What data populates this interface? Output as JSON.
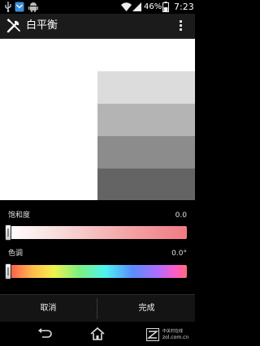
{
  "status_bar": {
    "battery_percent": "46%",
    "time": "7:23",
    "icons": [
      "usb-icon",
      "notification-icon",
      "android-icon",
      "wifi-icon",
      "signal-icon",
      "battery-icon"
    ]
  },
  "action_bar": {
    "title": "白平衡",
    "icon": "tools-icon",
    "menu_icon": "overflow-menu-icon"
  },
  "preview": {
    "background_color": "#ffffff",
    "gray_swatches": [
      "#dcdcdc",
      "#b4b4b4",
      "#8c8c8c",
      "#646464"
    ]
  },
  "controls": {
    "saturation": {
      "label": "饱和度",
      "value": "0.0",
      "level": 0
    },
    "hue": {
      "label": "色调",
      "value": "0.0°",
      "level": 0
    }
  },
  "buttons": {
    "cancel_label": "取消",
    "done_label": "完成"
  },
  "nav_bar": {
    "icons": [
      "back-icon",
      "home-icon"
    ],
    "watermark_line1": "中关村在线",
    "watermark_line2": "zol.com.cn"
  }
}
